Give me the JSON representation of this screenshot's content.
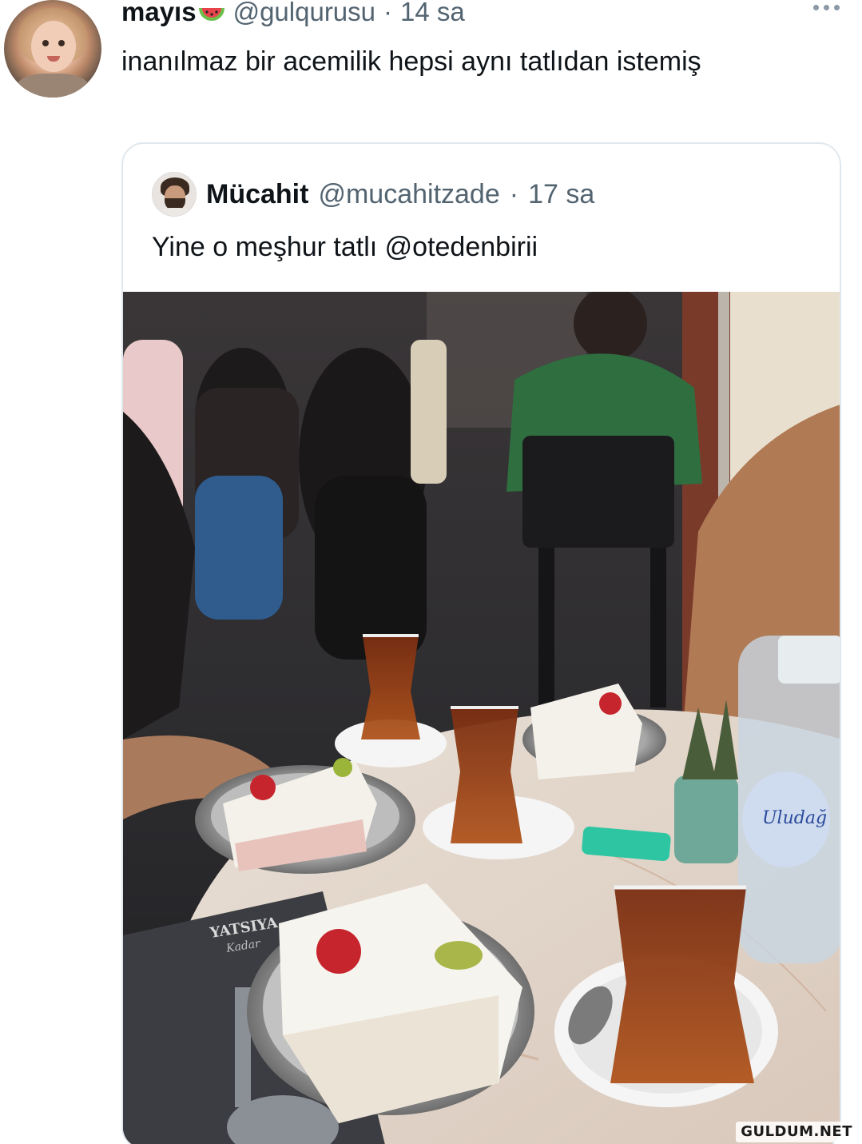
{
  "tweet": {
    "display_name": "mayıs",
    "name_emoji": "watermelon-icon",
    "handle": "@gulqurusu",
    "separator": "·",
    "time": "14 sa",
    "text": "inanılmaz bir acemilik hepsi aynı tatlıdan istemiş"
  },
  "quoted_tweet": {
    "display_name": "Mücahit",
    "handle": "@mucahitzade",
    "separator": "·",
    "time": "17 sa",
    "text": "Yine o meşhur tatlı @otedenbirii"
  },
  "photo": {
    "menu_text_top": "YATSIYA",
    "menu_text_bottom": "Kadar",
    "bottle_label": "Uludağ"
  },
  "watermark": "GULDUM.NET",
  "colors": {
    "secondary_text": "#536471",
    "primary_text": "#0f1419",
    "border": "#e1e8ed"
  }
}
